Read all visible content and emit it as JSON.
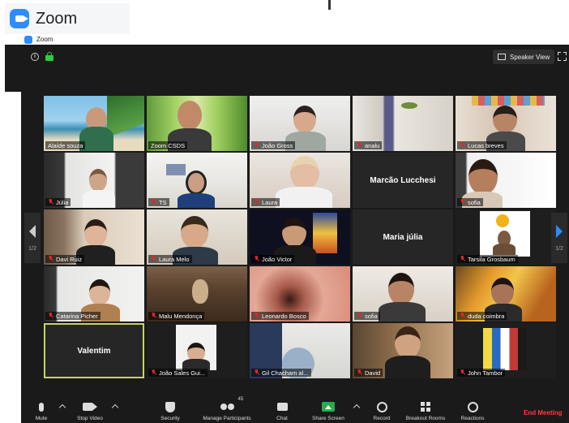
{
  "app": {
    "title": "Zoom",
    "window_title": "Zoom"
  },
  "top_bar": {
    "speaker_view_label": "Speaker View"
  },
  "participants": [
    {
      "name": "Alaíde souza",
      "muted": false
    },
    {
      "name": "Zoom CSDS",
      "muted": false
    },
    {
      "name": "João Gross",
      "muted": true
    },
    {
      "name": "analu",
      "muted": true
    },
    {
      "name": "Lucas breves",
      "muted": true
    },
    {
      "name": "Júlia",
      "muted": true
    },
    {
      "name": "TS",
      "muted": true
    },
    {
      "name": "Laura",
      "muted": true
    },
    {
      "name": "Marcão Lucchesi",
      "muted": false,
      "video_off": true
    },
    {
      "name": "sofia",
      "muted": true
    },
    {
      "name": "Davi Ruiz",
      "muted": true
    },
    {
      "name": "Laura Melo",
      "muted": true
    },
    {
      "name": "João Victor",
      "muted": true
    },
    {
      "name": "Maria júlia",
      "muted": false,
      "video_off": true
    },
    {
      "name": "Tarsila Grosbaum",
      "muted": true
    },
    {
      "name": "Catarina Picher",
      "muted": true
    },
    {
      "name": "Malu Mendonça",
      "muted": true
    },
    {
      "name": "Leonardo Bosco",
      "muted": true
    },
    {
      "name": "sofia",
      "muted": true
    },
    {
      "name": "duda coimbra",
      "muted": true
    },
    {
      "name": "Valentim",
      "muted": false,
      "video_off": true,
      "active_speaker": true
    },
    {
      "name": "João Sales Gui...",
      "muted": true
    },
    {
      "name": "Gil Chacham al...",
      "muted": true
    },
    {
      "name": "David",
      "muted": true
    },
    {
      "name": "John Tambor",
      "muted": true
    }
  ],
  "pagination": {
    "left": "1/2",
    "right": "1/2"
  },
  "toolbar": {
    "mute": "Mute",
    "stop_video": "Stop Video",
    "security": "Security",
    "manage_participants": "Manage Participants",
    "participant_count": "45",
    "chat": "Chat",
    "share_screen": "Share Screen",
    "record": "Record",
    "breakout_rooms": "Breakout Rooms",
    "reactions": "Reactions",
    "end_meeting": "End Meeting"
  },
  "colors": {
    "zoom_blue": "#2d8cff",
    "muted_red": "#e02828",
    "end_red": "#ff3b3b",
    "share_green": "#23b14d",
    "active_border": "#c9d26a"
  }
}
